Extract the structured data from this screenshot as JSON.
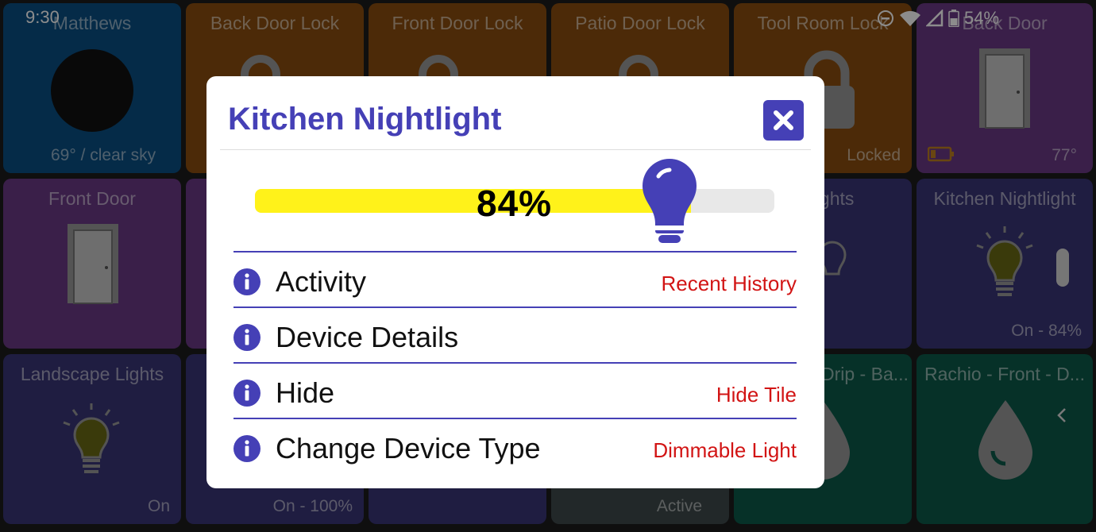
{
  "status_bar": {
    "time": "9:30",
    "battery": "54%"
  },
  "tiles": {
    "matthews": {
      "title": "Matthews",
      "status": "69° /  clear sky"
    },
    "back_door_lock": {
      "title": "Back Door Lock"
    },
    "front_door_lock": {
      "title": "Front Door Lock"
    },
    "patio_door_lock": {
      "title": "Patio Door Lock"
    },
    "tool_room_lock": {
      "title": "Tool Room Lock",
      "status": "Locked"
    },
    "back_door": {
      "title": "Back Door",
      "status": "77°"
    },
    "front_door": {
      "title": "Front Door"
    },
    "lights": {
      "title": "Lights"
    },
    "kitchen_nightlight": {
      "title": "Kitchen Nightlight",
      "status": "On - 84%"
    },
    "landscape_lights": {
      "title": "Landscape Lights",
      "status": "On"
    },
    "tile_row3_col2": {
      "status": "On - 100%"
    },
    "tile_row3_col4": {
      "status": "Active"
    },
    "drip": {
      "title": "Drip - Ba..."
    },
    "rachio_front": {
      "title": "Rachio - Front - D..."
    }
  },
  "dialog": {
    "title": "Kitchen Nightlight",
    "level": {
      "percent": 84,
      "label": "84%"
    },
    "options": [
      {
        "label": "Activity",
        "action": "Recent History"
      },
      {
        "label": "Device Details",
        "action": ""
      },
      {
        "label": "Hide",
        "action": "Hide Tile"
      },
      {
        "label": "Change Device Type",
        "action": "Dimmable Light"
      }
    ]
  },
  "colors": {
    "accent": "#4540b6",
    "slider_fill": "#fff21a",
    "action_red": "#d21414",
    "tile_blue": "#0a4f84",
    "tile_orange": "#8a4e10",
    "tile_purple": "#6a3a86",
    "tile_navy": "#3a3577",
    "tile_teal": "#0c5a4a"
  }
}
